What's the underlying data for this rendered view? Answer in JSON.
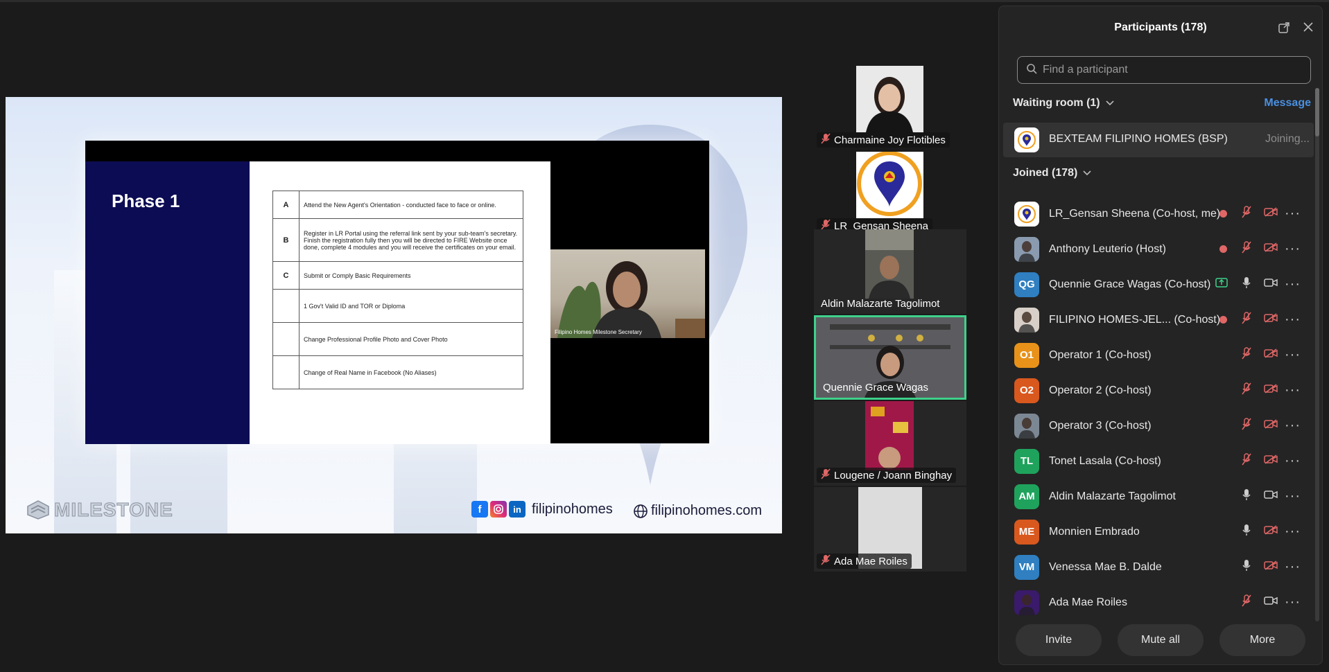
{
  "share": {
    "slide_title": "Phase 1",
    "rows": [
      {
        "key": "A",
        "text": "Attend the New Agent's Orientation - conducted face to face or online."
      },
      {
        "key": "B",
        "text": "Register in LR Portal using the referral link sent by your sub-team's secretary. Finish the registration fully then you will be directed to FIRE Website once done, complete 4 modules and you will receive the certificates on your email."
      },
      {
        "key": "C",
        "text": "Submit or Comply Basic Requirements"
      },
      {
        "key": "",
        "text": "1 Gov't Valid ID and TOR or Diploma"
      },
      {
        "key": "",
        "text": "Change Professional Profile Photo and Cover Photo"
      },
      {
        "key": "",
        "text": "Change of Real Name in Facebook (No Aliases)"
      }
    ],
    "cam_caption": "Filipino Homes Milestone Secretary",
    "brand": "MILESTONE",
    "social_handle": "filipinohomes",
    "website": "filipinohomes.com",
    "social_icons": [
      "facebook-icon",
      "instagram-icon",
      "linkedin-icon"
    ]
  },
  "gallery": [
    {
      "name": "Charmaine Joy Flotibles",
      "muted": true
    },
    {
      "name": "LR_Gensan Sheena",
      "muted": true
    },
    {
      "name": "Aldin Malazarte Tagolimot",
      "muted": false
    },
    {
      "name": "Quennie Grace Wagas",
      "muted": false,
      "active": true
    },
    {
      "name": "Lougene / Joann Binghay",
      "muted": true
    },
    {
      "name": "Ada Mae Roiles",
      "muted": true
    }
  ],
  "panel": {
    "title": "Participants (178)",
    "search_placeholder": "Find a participant",
    "waiting_label": "Waiting room (1)",
    "message_label": "Message",
    "waiting_name": "BEXTEAM FILIPINO HOMES (BSP)",
    "waiting_status": "Joining...",
    "joined_label": "Joined (178)",
    "participants": [
      {
        "name": "LR_Gensan Sheena (Co-host, me)",
        "initials": "",
        "avatar": "pin",
        "color": "#ffffff",
        "rec": true,
        "mic": "muted",
        "video": "off"
      },
      {
        "name": "Anthony Leuterio (Host)",
        "initials": "",
        "avatar": "photo",
        "color": "#8a9bb0",
        "rec": true,
        "mic": "muted",
        "video": "off"
      },
      {
        "name": "Quennie Grace Wagas (Co-host)",
        "initials": "QG",
        "avatar": "initials",
        "color": "#2f7fc1",
        "share": true,
        "mic": "on",
        "video": "on"
      },
      {
        "name": "FILIPINO HOMES-JEL...  (Co-host)",
        "initials": "",
        "avatar": "photo",
        "color": "#d8d0c8",
        "rec": true,
        "mic": "muted",
        "video": "off"
      },
      {
        "name": "Operator 1 (Co-host)",
        "initials": "O1",
        "avatar": "initials",
        "color": "#e8921a",
        "mic": "muted",
        "video": "off"
      },
      {
        "name": "Operator 2 (Co-host)",
        "initials": "O2",
        "avatar": "initials",
        "color": "#d9581e",
        "mic": "muted",
        "video": "off"
      },
      {
        "name": "Operator 3 (Co-host)",
        "initials": "",
        "avatar": "photo",
        "color": "#7c8794",
        "mic": "muted",
        "video": "off"
      },
      {
        "name": "Tonet Lasala (Co-host)",
        "initials": "TL",
        "avatar": "initials",
        "color": "#1fa35c",
        "mic": "muted",
        "video": "off"
      },
      {
        "name": "Aldin Malazarte Tagolimot",
        "initials": "AM",
        "avatar": "initials",
        "color": "#1fa35c",
        "mic": "on",
        "video": "on"
      },
      {
        "name": "Monnien Embrado",
        "initials": "ME",
        "avatar": "initials",
        "color": "#d9581e",
        "mic": "on",
        "video": "off"
      },
      {
        "name": "Venessa Mae B. Dalde",
        "initials": "VM",
        "avatar": "initials",
        "color": "#2f7fc1",
        "mic": "on",
        "video": "off"
      },
      {
        "name": "Ada Mae Roiles",
        "initials": "",
        "avatar": "photo",
        "color": "#3a1a6a",
        "mic": "muted",
        "video": "on"
      }
    ],
    "footer": {
      "invite": "Invite",
      "mute_all": "Mute all",
      "more": "More"
    }
  },
  "colors": {
    "accent_green": "#3ed18b",
    "link_blue": "#4a90e2",
    "muted_red": "#e06767",
    "navy": "#0c0c54"
  }
}
